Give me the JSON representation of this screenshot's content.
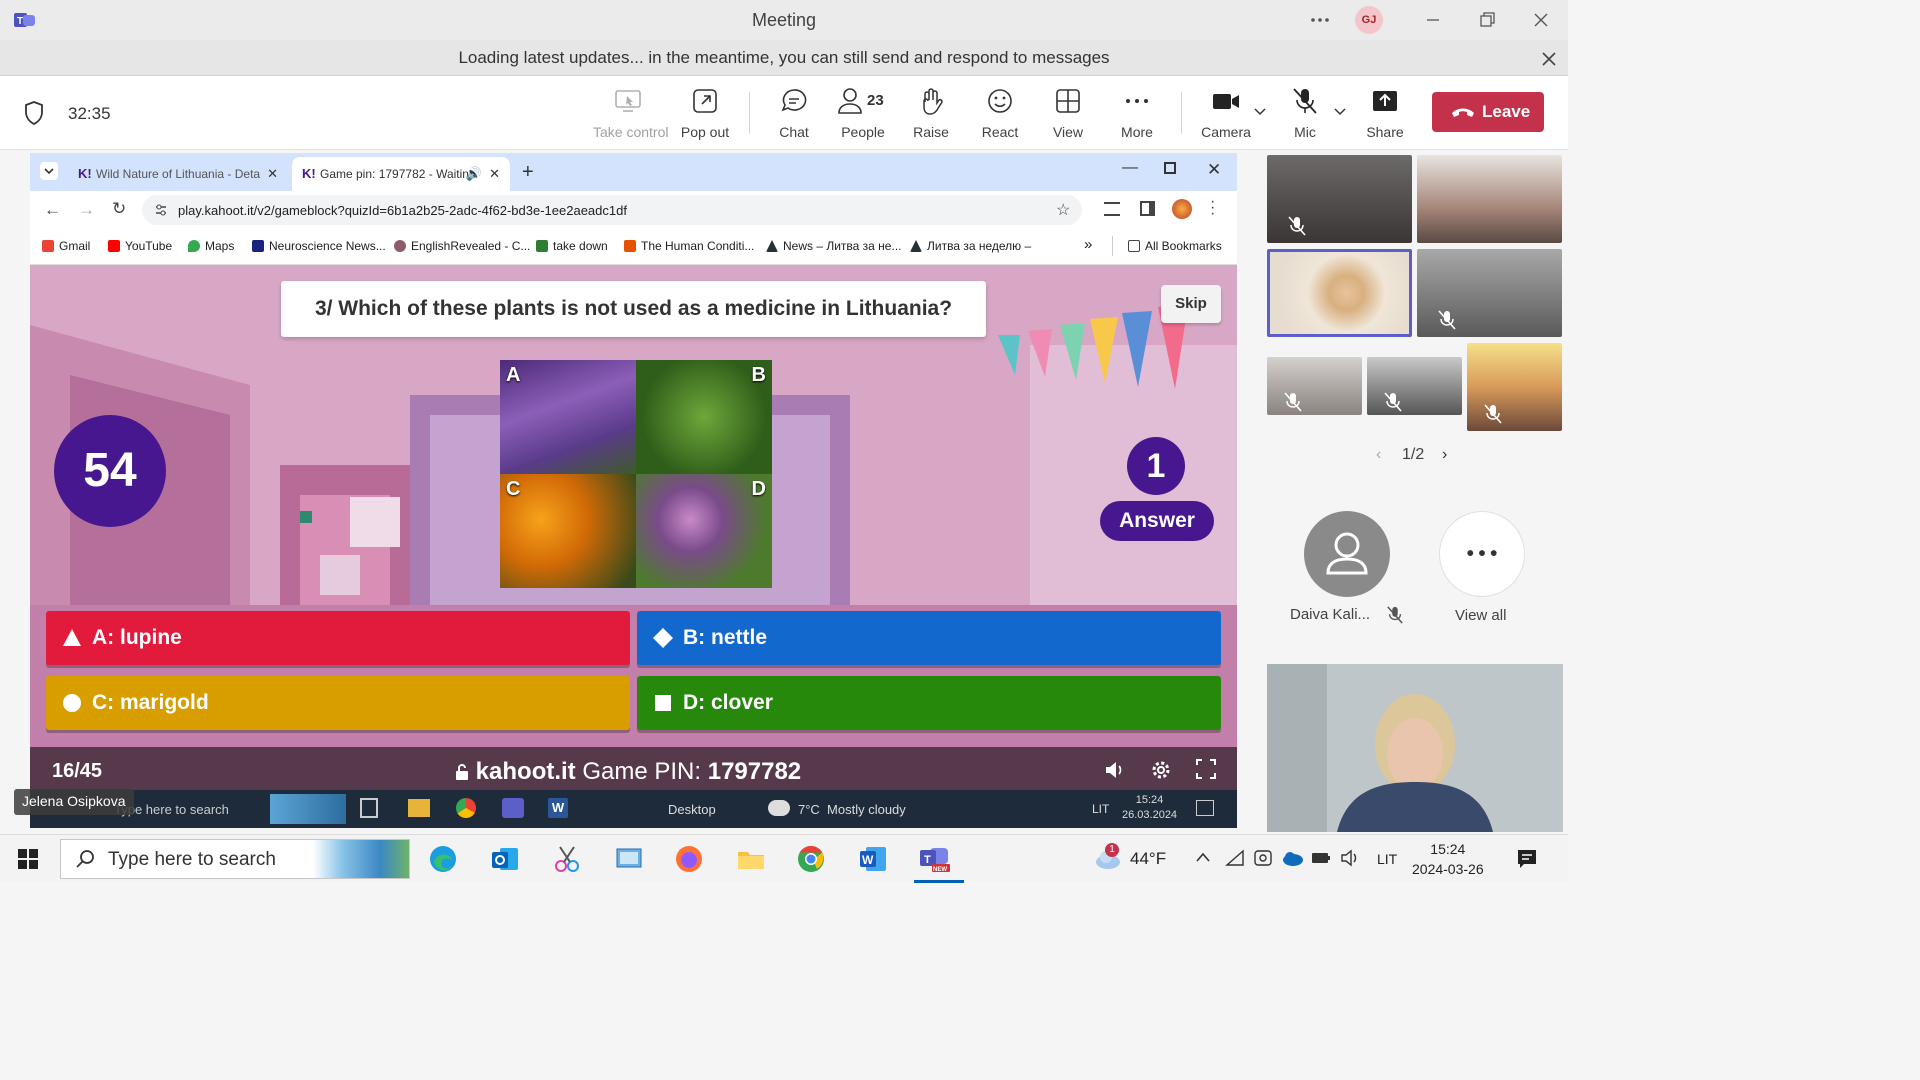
{
  "window": {
    "title": "Meeting",
    "avatar_initials": "GJ"
  },
  "banner": {
    "text": "Loading latest updates... in the meantime, you can still send and respond to messages"
  },
  "toolbar": {
    "timer": "32:35",
    "take_control": "Take control",
    "pop_out": "Pop out",
    "chat": "Chat",
    "people": "People",
    "people_count": "23",
    "raise": "Raise",
    "react": "React",
    "view": "View",
    "more": "More",
    "camera": "Camera",
    "mic": "Mic",
    "share": "Share",
    "leave": "Leave"
  },
  "browser": {
    "tabs": [
      {
        "label": "Wild Nature of Lithuania - Deta"
      },
      {
        "label": "Game pin: 1797782 - Waitin"
      }
    ],
    "url": "play.kahoot.it/v2/gameblock?quizId=6b1a2b25-2adc-4f62-bd3e-1ee2aeadc1df",
    "bookmarks": [
      "Gmail",
      "YouTube",
      "Maps",
      "Neuroscience News...",
      "EnglishRevealed - C...",
      "take down",
      "The Human Conditi...",
      "News – Литва за не...",
      "Литва за неделю –"
    ],
    "all_bookmarks": "All Bookmarks"
  },
  "kahoot": {
    "question": "3/ Which of these plants is not used as a medicine in Lithuania?",
    "skip": "Skip",
    "timer": "54",
    "answer_count": "1",
    "answer_label": "Answer",
    "image_letters": [
      "A",
      "B",
      "C",
      "D"
    ],
    "answers": [
      {
        "label": "A: lupine",
        "color": "#e21b3c"
      },
      {
        "label": "B: nettle",
        "color": "#1368ce"
      },
      {
        "label": "C: marigold",
        "color": "#d89e00"
      },
      {
        "label": "D: clover",
        "color": "#26890c"
      }
    ],
    "progress": "16/45",
    "site": "kahoot.it",
    "pin_label": "Game PIN:",
    "pin": "1797782"
  },
  "remote_taskbar": {
    "search": "Type here to search",
    "desktop": "Desktop",
    "weather": "7°C  Mostly cloudy",
    "lang": "LIT",
    "time": "15:24",
    "date": "26.03.2024"
  },
  "presenter_name": "Jelena Osipkova",
  "participants": {
    "pager": "1/2",
    "daiva": "Daiva  Kali...",
    "view_all": "View all"
  },
  "taskbar": {
    "search": "Type here to search",
    "temp": "44°F",
    "weather_badge": "1",
    "lang": "LIT",
    "time": "15:24",
    "date": "2024-03-26"
  }
}
